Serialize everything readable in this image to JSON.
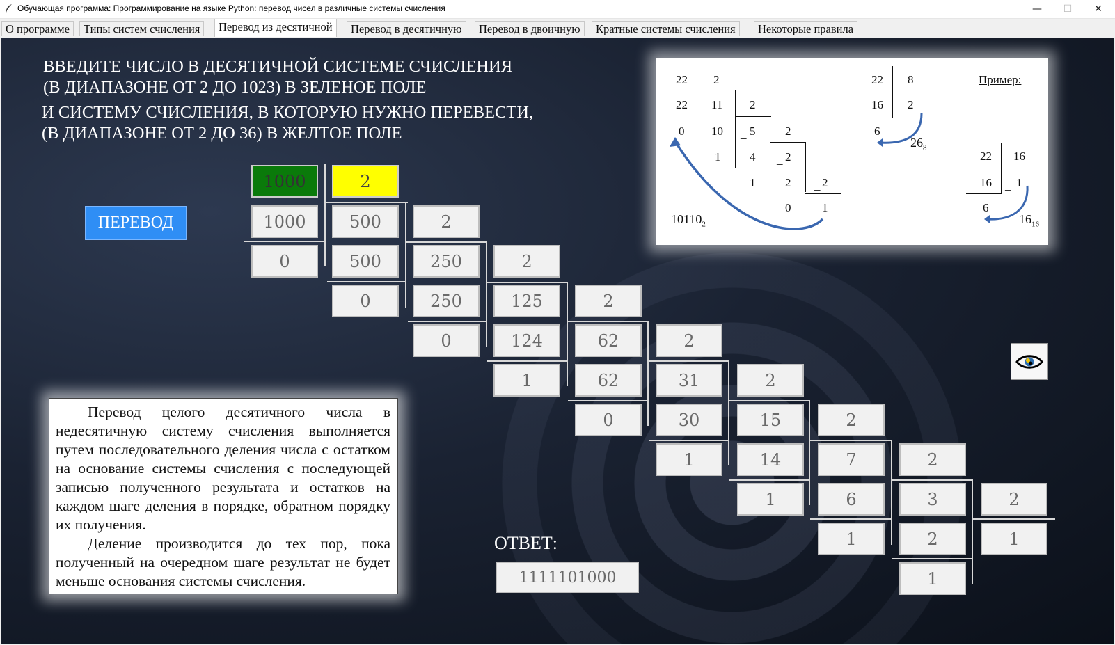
{
  "window": {
    "title": "Обучающая программа: Программирование на языке Python: перевод чисел в различные системы счисления",
    "minimize_glyph": "—",
    "maximize_glyph": "☐",
    "close_glyph": "✕"
  },
  "tabs": [
    {
      "label": "О программе"
    },
    {
      "label": "Типы систем счисления"
    },
    {
      "label": "Перевод из десятичной"
    },
    {
      "label": "Перевод в десятичную"
    },
    {
      "label": "Перевод в двоичную"
    },
    {
      "label": "Кратные системы счисления"
    },
    {
      "label": "Некоторые правила"
    }
  ],
  "active_tab": "Перевод из десятичной",
  "heading": {
    "line1": "ВВЕДИТЕ ЧИСЛО В ДЕСЯТИЧНОЙ СИСТЕМЕ СЧИСЛЕНИЯ",
    "line2": "(В ДИАПАЗОНЕ ОТ 2 ДО 1023) В ЗЕЛЕНОЕ ПОЛЕ",
    "line3": "И СИСТЕМУ СЧИСЛЕНИЯ, В КОТОРУЮ НУЖНО ПЕРЕВЕСТИ,",
    "line4": "(В ДИАПАЗОНЕ ОТ 2 ДО 36) В ЖЕЛТОЕ ПОЛЕ"
  },
  "inputs": {
    "number_value": "1000",
    "base_value": "2",
    "number_color": "#0a7a0a",
    "base_color": "#ffff00"
  },
  "convert_button": {
    "label": "ПЕРЕВОД",
    "color": "#2f8ef5"
  },
  "division_cells": {
    "r1": [
      "1000",
      "500",
      "2"
    ],
    "r2": [
      "0",
      "500",
      "250",
      "2"
    ],
    "r3": [
      "0",
      "250",
      "125",
      "2"
    ],
    "r4": [
      "0",
      "124",
      "62",
      "2"
    ],
    "r5": [
      "1",
      "62",
      "31",
      "2"
    ],
    "r6": [
      "0",
      "30",
      "15",
      "2"
    ],
    "r7": [
      "1",
      "14",
      "7",
      "2"
    ],
    "r8": [
      "1",
      "6",
      "3",
      "2"
    ],
    "r9": [
      "1",
      "2",
      "1"
    ],
    "r10": [
      "1"
    ]
  },
  "info": {
    "p1": "Перевод целого десятичного числа в недесятичную систему счисления выполняется путем последовательного деления числа с остатком на основание системы счисления с последующей записью полученного результата и остатков на каждом шаге деления в порядке, обратном порядку их получения.",
    "p2": "Деление производится до тех пор, пока полученный на очередном шаге результат не будет меньше основания системы счисления."
  },
  "answer": {
    "label": "ОТВЕТ:",
    "value": "1111101000"
  },
  "example": {
    "title": "Пример:",
    "a": {
      "n22": "22",
      "d2": "2",
      "s22": "22",
      "q11": "11",
      "d2b": "2",
      "r0": "0",
      "s10": "10",
      "q5": "5",
      "d2c": "2",
      "r1": "1",
      "s4": "4",
      "q2": "2",
      "d2d": "2",
      "r1b": "1",
      "s2": "2",
      "q1": "2",
      "r0b": "0",
      "q1b": "1",
      "result": "10110",
      "result_sub": "2"
    },
    "b": {
      "n22": "22",
      "d8": "8",
      "s16": "16",
      "q2": "2",
      "r6": "6",
      "result": "26",
      "result_sub": "8"
    },
    "c": {
      "n22": "22",
      "d16": "16",
      "s16": "16",
      "q1": "1",
      "r6": "6",
      "result": "16",
      "result_sub": "16"
    },
    "minus": "_"
  },
  "eye_icon": "eye-icon"
}
